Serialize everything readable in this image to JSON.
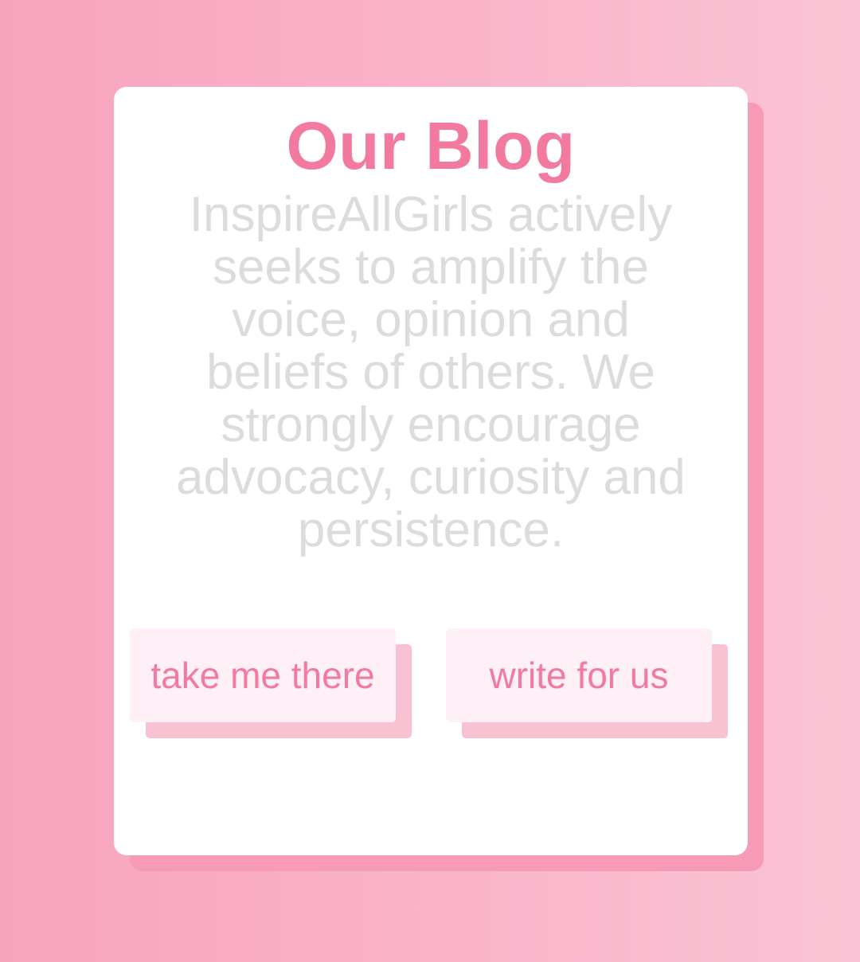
{
  "blog": {
    "title": "Our Blog",
    "description": "InspireAllGirls actively seeks to amplify the voice, opinion and beliefs of others. We strongly encourage advocacy, curiosity and persistence.",
    "primary_button_label": "take me there",
    "secondary_button_label": "write for us"
  },
  "colors": {
    "accent": "#f27a9f",
    "background_start": "#f8a3bd",
    "background_end": "#fbc3d5",
    "card": "#ffffff",
    "button_bg": "#fff0f7",
    "button_shadow": "#f9c2d3",
    "card_shadow": "#f79ab6",
    "description_text": "#dcdcdc"
  }
}
